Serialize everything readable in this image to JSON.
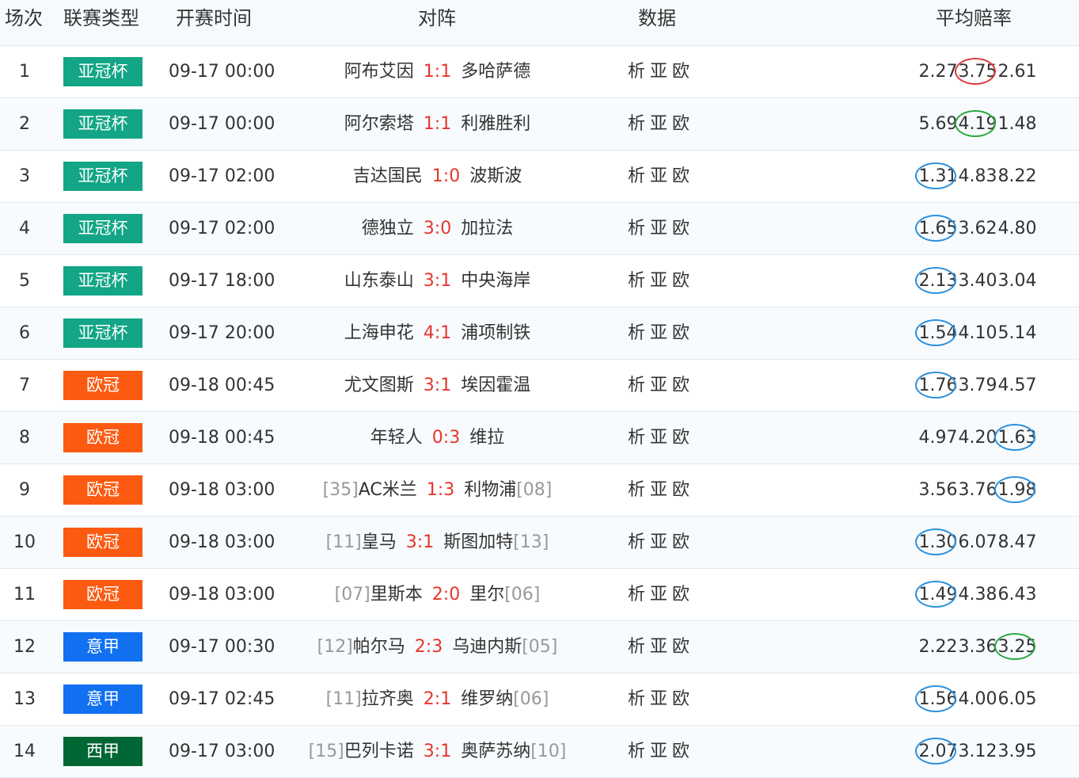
{
  "header": {
    "col_idx": "场次",
    "col_league": "联赛类型",
    "col_time": "开赛时间",
    "col_match": "对阵",
    "col_data": "数据",
    "col_odds": "平均赔率"
  },
  "colors": {
    "acl": "#12a586",
    "ucl": "#fc5a10",
    "seriea": "#1070f0",
    "laliga": "#006633",
    "score": "#e8352b",
    "circle_red": "#e23a3a",
    "circle_green": "#2aa83c",
    "circle_blue": "#2a8fdc"
  },
  "data_links": [
    "析",
    "亚",
    "欧"
  ],
  "rows": [
    {
      "idx": "1",
      "league": "亚冠杯",
      "league_color": "#12a586",
      "time": "09-17 00:00",
      "home_rank": "",
      "home": "阿布艾因",
      "score": "1:1",
      "away": "多哈萨德",
      "away_rank": "",
      "odds": [
        "2.27",
        "3.75",
        "2.61"
      ],
      "circle": 1,
      "circle_color": "red"
    },
    {
      "idx": "2",
      "league": "亚冠杯",
      "league_color": "#12a586",
      "time": "09-17 00:00",
      "home_rank": "",
      "home": "阿尔索塔",
      "score": "1:1",
      "away": "利雅胜利",
      "away_rank": "",
      "odds": [
        "5.69",
        "4.19",
        "1.48"
      ],
      "circle": 1,
      "circle_color": "green"
    },
    {
      "idx": "3",
      "league": "亚冠杯",
      "league_color": "#12a586",
      "time": "09-17 02:00",
      "home_rank": "",
      "home": "吉达国民",
      "score": "1:0",
      "away": "波斯波",
      "away_rank": "",
      "odds": [
        "1.31",
        "4.83",
        "8.22"
      ],
      "circle": 0,
      "circle_color": "blue"
    },
    {
      "idx": "4",
      "league": "亚冠杯",
      "league_color": "#12a586",
      "time": "09-17 02:00",
      "home_rank": "",
      "home": "德独立",
      "score": "3:0",
      "away": "加拉法",
      "away_rank": "",
      "odds": [
        "1.65",
        "3.62",
        "4.80"
      ],
      "circle": 0,
      "circle_color": "blue"
    },
    {
      "idx": "5",
      "league": "亚冠杯",
      "league_color": "#12a586",
      "time": "09-17 18:00",
      "home_rank": "",
      "home": "山东泰山",
      "score": "3:1",
      "away": "中央海岸",
      "away_rank": "",
      "odds": [
        "2.13",
        "3.40",
        "3.04"
      ],
      "circle": 0,
      "circle_color": "blue"
    },
    {
      "idx": "6",
      "league": "亚冠杯",
      "league_color": "#12a586",
      "time": "09-17 20:00",
      "home_rank": "",
      "home": "上海申花",
      "score": "4:1",
      "away": "浦项制铁",
      "away_rank": "",
      "odds": [
        "1.54",
        "4.10",
        "5.14"
      ],
      "circle": 0,
      "circle_color": "blue"
    },
    {
      "idx": "7",
      "league": "欧冠",
      "league_color": "#fc5a10",
      "time": "09-18 00:45",
      "home_rank": "",
      "home": "尤文图斯",
      "score": "3:1",
      "away": "埃因霍温",
      "away_rank": "",
      "odds": [
        "1.76",
        "3.79",
        "4.57"
      ],
      "circle": 0,
      "circle_color": "blue"
    },
    {
      "idx": "8",
      "league": "欧冠",
      "league_color": "#fc5a10",
      "time": "09-18 00:45",
      "home_rank": "",
      "home": "年轻人",
      "score": "0:3",
      "away": "维拉",
      "away_rank": "",
      "odds": [
        "4.97",
        "4.20",
        "1.63"
      ],
      "circle": 2,
      "circle_color": "blue"
    },
    {
      "idx": "9",
      "league": "欧冠",
      "league_color": "#fc5a10",
      "time": "09-18 03:00",
      "home_rank": "[35]",
      "home": "AC米兰",
      "score": "1:3",
      "away": "利物浦",
      "away_rank": "[08]",
      "odds": [
        "3.56",
        "3.76",
        "1.98"
      ],
      "circle": 2,
      "circle_color": "blue"
    },
    {
      "idx": "10",
      "league": "欧冠",
      "league_color": "#fc5a10",
      "time": "09-18 03:00",
      "home_rank": "[11]",
      "home": "皇马",
      "score": "3:1",
      "away": "斯图加特",
      "away_rank": "[13]",
      "odds": [
        "1.30",
        "6.07",
        "8.47"
      ],
      "circle": 0,
      "circle_color": "blue"
    },
    {
      "idx": "11",
      "league": "欧冠",
      "league_color": "#fc5a10",
      "time": "09-18 03:00",
      "home_rank": "[07]",
      "home": "里斯本",
      "score": "2:0",
      "away": "里尔",
      "away_rank": "[06]",
      "odds": [
        "1.49",
        "4.38",
        "6.43"
      ],
      "circle": 0,
      "circle_color": "blue"
    },
    {
      "idx": "12",
      "league": "意甲",
      "league_color": "#1070f0",
      "time": "09-17 00:30",
      "home_rank": "[12]",
      "home": "帕尔马",
      "score": "2:3",
      "away": "乌迪内斯",
      "away_rank": "[05]",
      "odds": [
        "2.22",
        "3.36",
        "3.25"
      ],
      "circle": 2,
      "circle_color": "green"
    },
    {
      "idx": "13",
      "league": "意甲",
      "league_color": "#1070f0",
      "time": "09-17 02:45",
      "home_rank": "[11]",
      "home": "拉齐奥",
      "score": "2:1",
      "away": "维罗纳",
      "away_rank": "[06]",
      "odds": [
        "1.56",
        "4.00",
        "6.05"
      ],
      "circle": 0,
      "circle_color": "blue"
    },
    {
      "idx": "14",
      "league": "西甲",
      "league_color": "#006633",
      "time": "09-17 03:00",
      "home_rank": "[15]",
      "home": "巴列卡诺",
      "score": "3:1",
      "away": "奥萨苏纳",
      "away_rank": "[10]",
      "odds": [
        "2.07",
        "3.12",
        "3.95"
      ],
      "circle": 0,
      "circle_color": "blue"
    }
  ]
}
